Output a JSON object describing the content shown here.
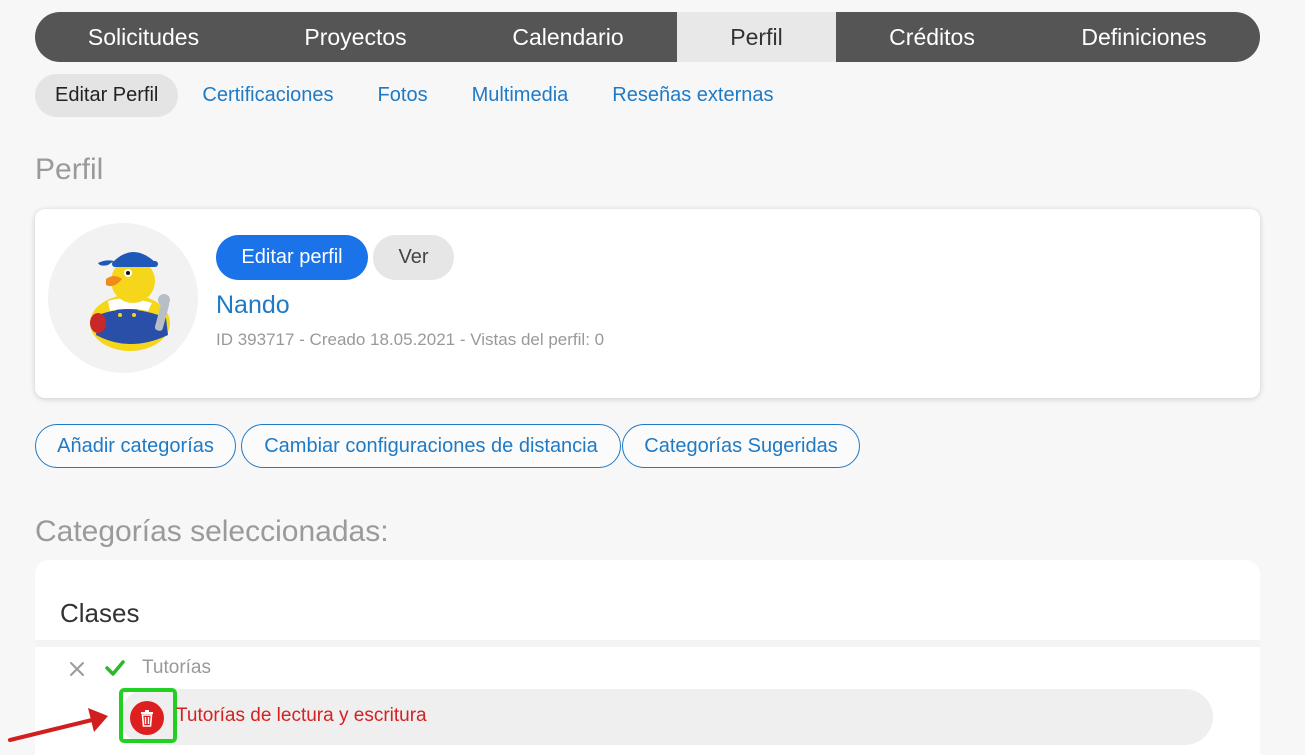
{
  "main_nav": {
    "tabs": [
      {
        "label": "Solicitudes"
      },
      {
        "label": "Proyectos"
      },
      {
        "label": "Calendario"
      },
      {
        "label": "Perfil"
      },
      {
        "label": "Créditos"
      },
      {
        "label": "Definiciones"
      }
    ],
    "active": "Perfil"
  },
  "sub_nav": {
    "items": [
      {
        "label": "Editar Perfil"
      },
      {
        "label": "Certificaciones"
      },
      {
        "label": "Fotos"
      },
      {
        "label": "Multimedia"
      },
      {
        "label": "Reseñas externas"
      }
    ],
    "active": "Editar Perfil"
  },
  "profile_section": {
    "title": "Perfil",
    "edit_button": "Editar perfil",
    "view_button": "Ver",
    "name": "Nando",
    "meta": "ID 393717 - Creado 18.05.2021 - Vistas del perfil: 0",
    "avatar_icon": "rubber-duck-plumber-avatar"
  },
  "actions": {
    "add_categories": "Añadir categorías",
    "distance_settings": "Cambiar configuraciones de distancia",
    "suggested_categories": "Categorías Sugeridas"
  },
  "categories": {
    "title": "Categorías seleccionadas:",
    "group": {
      "name": "Clases",
      "parent": "Tutorías",
      "subcategory": "Tutorías de lectura y escritura"
    }
  },
  "colors": {
    "nav_bg": "#555555",
    "link_blue": "#1f7ac6",
    "primary_blue": "#1a73e8",
    "delete_red": "#dd1f1f",
    "highlight_green": "#22d022",
    "check_green": "#2bb82b"
  },
  "icons": {
    "remove": "close-icon",
    "confirmed": "checkmark-icon",
    "delete": "trash-icon",
    "annotation": "red-arrow-icon"
  }
}
